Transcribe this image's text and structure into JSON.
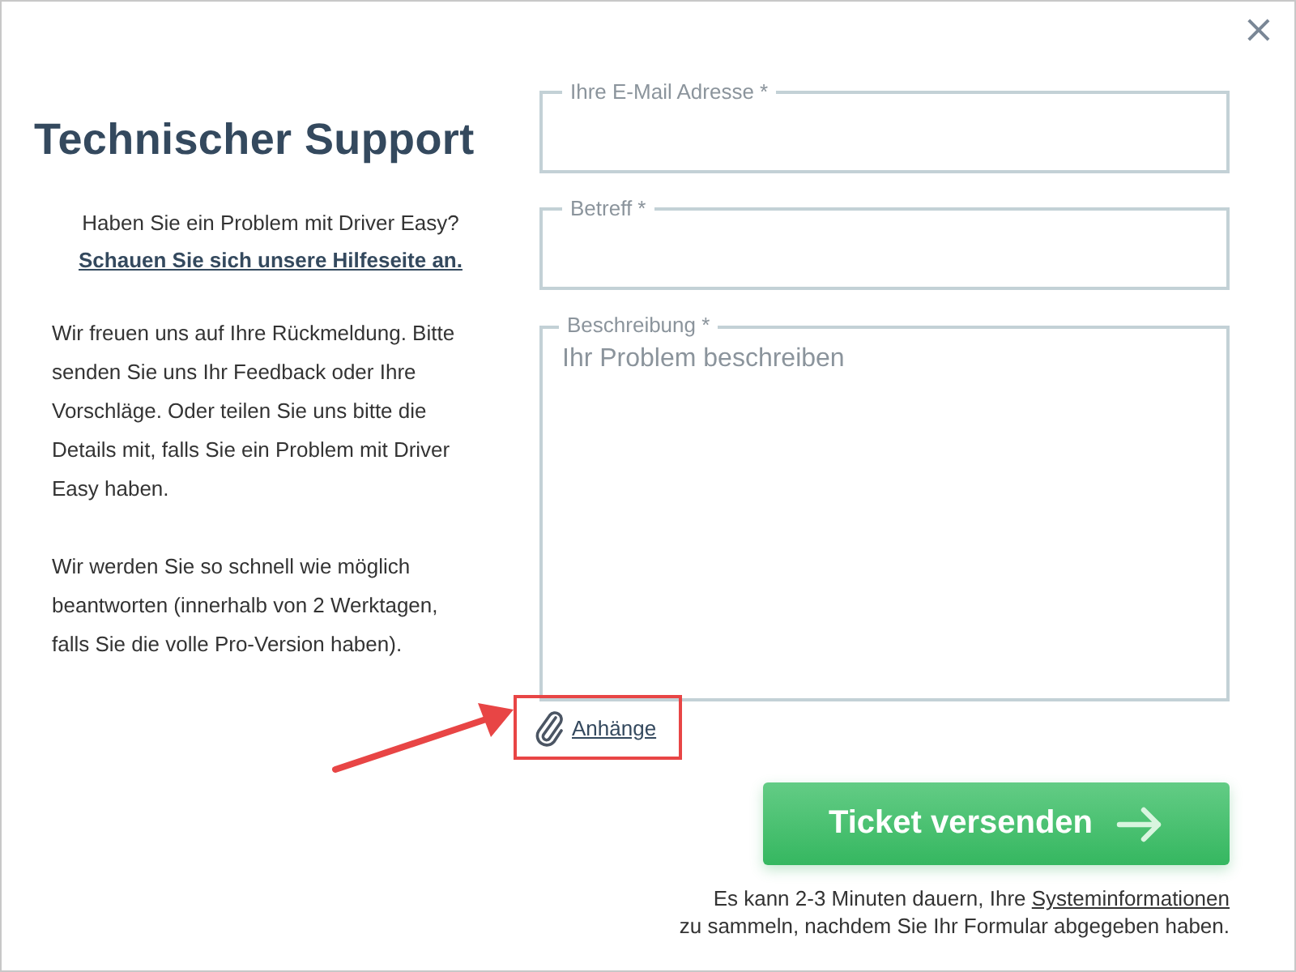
{
  "dialog": {
    "close_glyph": "×"
  },
  "title": "Technischer Support",
  "help": {
    "question": "Haben Sie ein Problem mit Driver Easy?",
    "link": "Schauen Sie sich unsere Hilfeseite an."
  },
  "paragraphs": [
    "Wir freuen uns auf Ihre Rückmeldung. Bitte senden Sie uns Ihr Feedback oder Ihre Vorschläge. Oder teilen Sie uns bitte die Details mit, falls Sie ein Problem mit Driver Easy haben.",
    "Wir werden Sie so schnell wie möglich beantworten (innerhalb von 2 Werktagen, falls Sie die volle Pro-Version haben)."
  ],
  "fields": [
    {
      "kind": "input",
      "label": "Ihre E-Mail Adresse *"
    },
    {
      "kind": "input",
      "label": "Betreff *"
    },
    {
      "kind": "textarea",
      "label": "Beschreibung *",
      "placeholder": "Ihr Problem beschreiben"
    }
  ],
  "attachments": {
    "label": "Anhänge",
    "highlighted": true
  },
  "submit": {
    "label": "Ticket versenden"
  },
  "note": {
    "before": "Es kann 2-3 Minuten dauern, Ihre ",
    "link": "Systeminformationen",
    "after": " zu sammeln, nachdem Sie Ihr Formular abgegeben haben."
  }
}
